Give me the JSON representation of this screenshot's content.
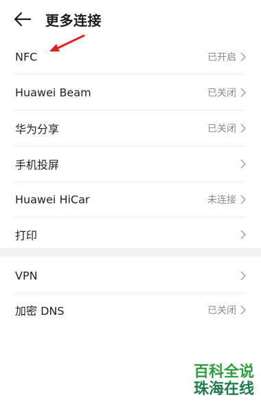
{
  "header": {
    "title": "更多连接",
    "back_icon": "back-arrow-icon"
  },
  "settings": [
    {
      "label": "NFC",
      "status": "已开启"
    },
    {
      "label": "Huawei Beam",
      "status": "已关闭"
    },
    {
      "label": "华为分享",
      "status": "已关闭"
    },
    {
      "label": "手机投屏",
      "status": ""
    },
    {
      "label": "Huawei HiCar",
      "status": "未连接"
    },
    {
      "label": "打印",
      "status": ""
    }
  ],
  "settings2": [
    {
      "label": "VPN",
      "status": ""
    },
    {
      "label": "加密 DNS",
      "status": "已关闭"
    }
  ],
  "annotation": {
    "color": "#e0221f",
    "icon": "red-arrow-icon"
  },
  "watermark": {
    "line1": "百科全说",
    "line2": "珠海在线"
  }
}
